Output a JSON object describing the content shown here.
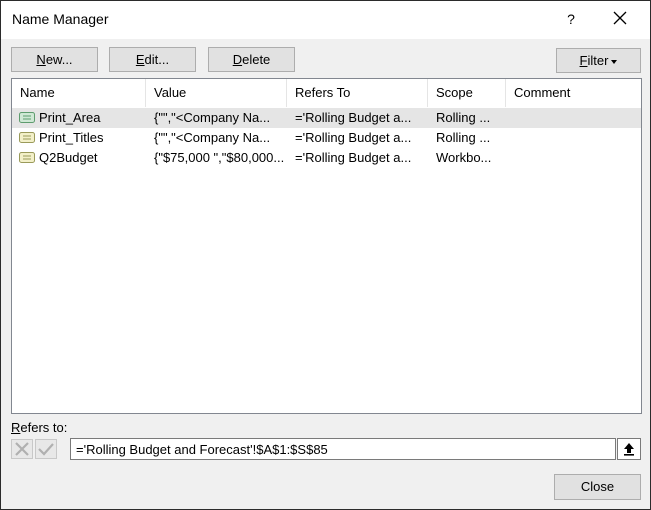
{
  "dialog": {
    "title": "Name Manager",
    "help": "?"
  },
  "toolbar": {
    "new_label": "New...",
    "new_key": "N",
    "new_rest": "ew...",
    "edit_label": "Edit...",
    "edit_key": "E",
    "edit_rest": "dit...",
    "delete_label": "Delete",
    "delete_key": "D",
    "delete_rest": "elete",
    "filter_label": "Filter",
    "filter_key": "F",
    "filter_rest": "ilter"
  },
  "table": {
    "headers": [
      "Name",
      "Value",
      "Refers To",
      "Scope",
      "Comment"
    ],
    "rows": [
      {
        "name": "Print_Area",
        "value": "{\"\",\"<Company Na...",
        "refers_to": "='Rolling Budget a...",
        "scope": "Rolling ...",
        "comment": "",
        "selected": true
      },
      {
        "name": "Print_Titles",
        "value": "{\"\",\"<Company Na...",
        "refers_to": "='Rolling Budget a...",
        "scope": "Rolling ...",
        "comment": "",
        "selected": false
      },
      {
        "name": "Q2Budget",
        "value": "{\"$75,000 \",\"$80,000...",
        "refers_to": "='Rolling Budget a...",
        "scope": "Workbo...",
        "comment": "",
        "selected": false
      }
    ]
  },
  "refers_to": {
    "label_key": "R",
    "label_rest": "efers to:",
    "value": "='Rolling Budget and Forecast'!$A$1:$S$85"
  },
  "footer": {
    "close_label": "Close"
  },
  "icons": {
    "help": "help-icon",
    "close": "close-icon",
    "name": "defined-name-icon",
    "cancel": "cancel-x-icon",
    "confirm": "confirm-check-icon",
    "collapse": "collapse-dialog-icon"
  },
  "colors": {
    "selected_row": "#e5e5e5",
    "dialog_bg": "#f0f0f0",
    "button_bg": "#e1e1e1",
    "icon_green": "#6aa77a"
  }
}
